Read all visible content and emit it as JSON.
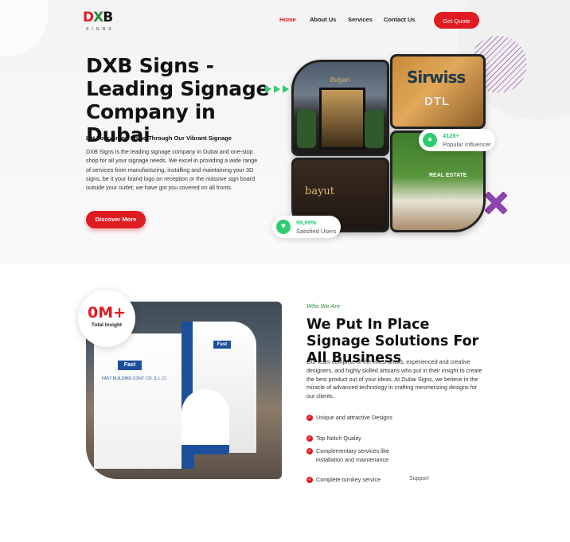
{
  "brand": {
    "mark_d": "D",
    "mark_x": "X",
    "mark_b": "B",
    "sub": "SIGNS"
  },
  "nav": {
    "items": [
      "Home",
      "About Us",
      "Services",
      "Contact Us"
    ],
    "cta": "Get Quote"
  },
  "hero": {
    "title": "DXB Signs - Leading Signage Company in Dubai",
    "subtitle": "Let Your Brand Shine Through Our Vibrant Signage",
    "paragraph": "DXB Signs is the leading  signage company in Dubai and one-stop shop for all your signage needs. We excel in providing a wide range of services from manufacturing, installing and maintaining your 3D signs, be it your brand logo on reception or the massive sign board outside your outlet; we have got you covered on all fronts.",
    "button": "Discover More",
    "badge_influencer": {
      "value": "4126+",
      "label": "Popular Influencer"
    },
    "badge_users": {
      "value": "99,99%",
      "label": "Satisfied Users"
    },
    "photo_texts": {
      "photo2_top": "Sirwiss",
      "photo2_bottom": "DTL",
      "photo3": "bayut",
      "photo4": "REAL ESTATE"
    }
  },
  "who": {
    "stat_value": "0M+",
    "stat_label": "Total Insight",
    "eyebrow": "Who We Are",
    "title": "We Put In Place Signage Solutions For All Business",
    "paragraph": "Our team comprise of the finest artists, experienced and creative designers, and highly skilled artisans who put in their insight to create the best product out of your ideas. At Dubai Signs, we believe in the miracle of advanced technology in crafting mesmerizing designs for our clients.",
    "features": [
      "Unique and attractive Designs",
      "Top Notch Quality",
      "Complementary services like installation and maintenance",
      "Complete turnkey service"
    ],
    "support": "Support",
    "booth_logo": "Fast",
    "booth_text": "FAST BUILDING CONT. CO. (L.L.C)"
  },
  "colors": {
    "accent": "#e11b22",
    "green": "#2ecc71",
    "purple": "#8e44ad",
    "booth_blue": "#1e4f9c"
  },
  "icons": [
    "user-icon",
    "check-icon",
    "heart-icon",
    "arrow-right-icon",
    "close-x-icon"
  ]
}
